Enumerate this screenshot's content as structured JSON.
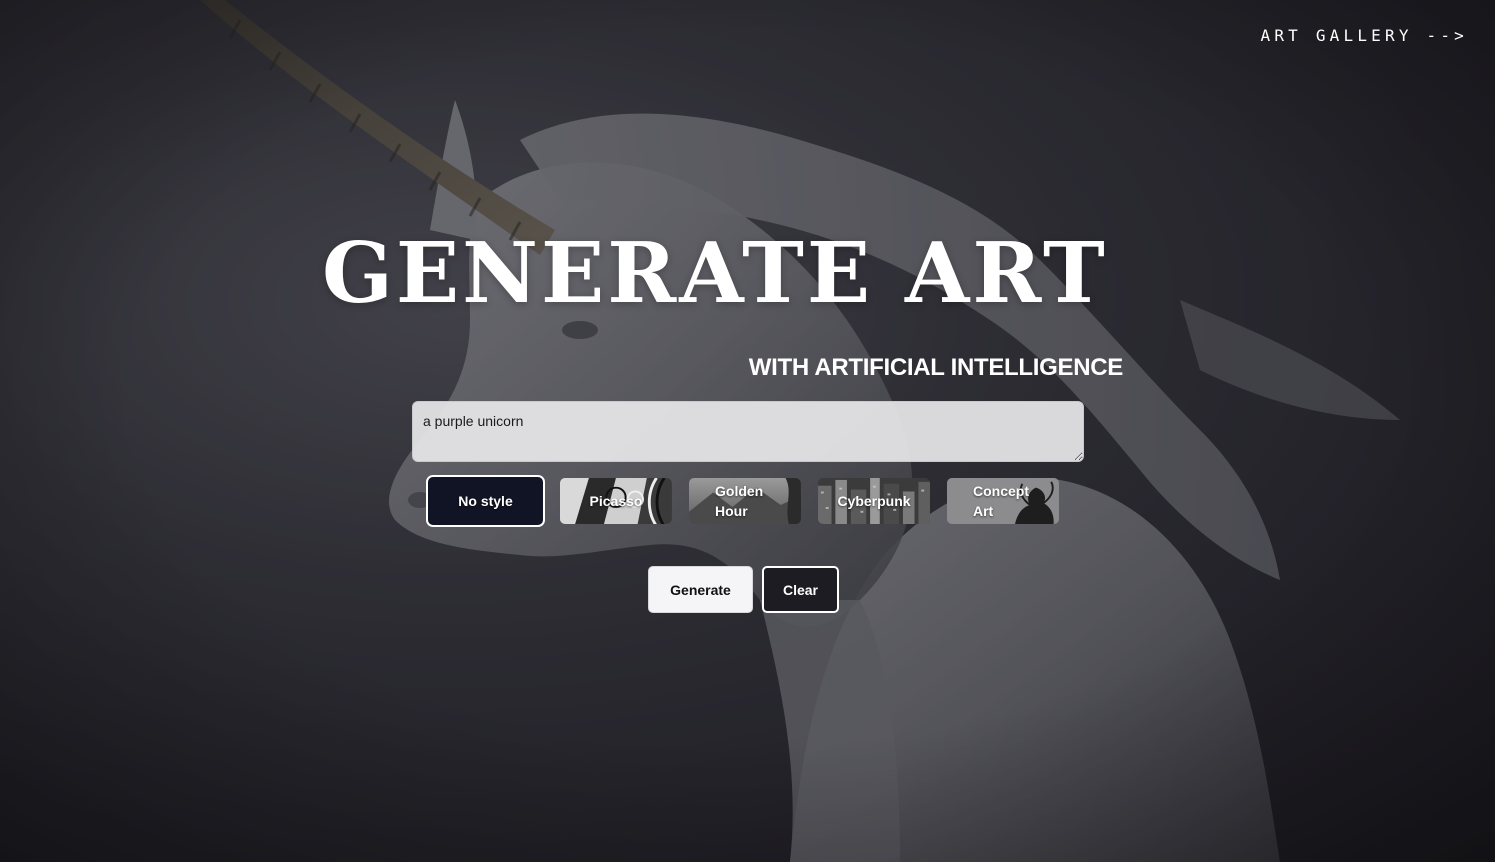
{
  "nav": {
    "gallery_link": "ART GALLERY -->"
  },
  "hero": {
    "title": "GENERATE ART",
    "subtitle": "WITH ARTIFICIAL INTELLIGENCE"
  },
  "prompt": {
    "value": "a purple unicorn"
  },
  "styles": {
    "selected": "No style",
    "items": [
      {
        "label": "No style"
      },
      {
        "label": "Picasso"
      },
      {
        "label": "Golden Hour"
      },
      {
        "label": "Cyberpunk"
      },
      {
        "label": "Concept Art"
      }
    ]
  },
  "actions": {
    "generate_label": "Generate",
    "clear_label": "Clear"
  },
  "colors": {
    "background": "#26252c",
    "selected_style_bg": "#111424",
    "text": "#ffffff"
  }
}
